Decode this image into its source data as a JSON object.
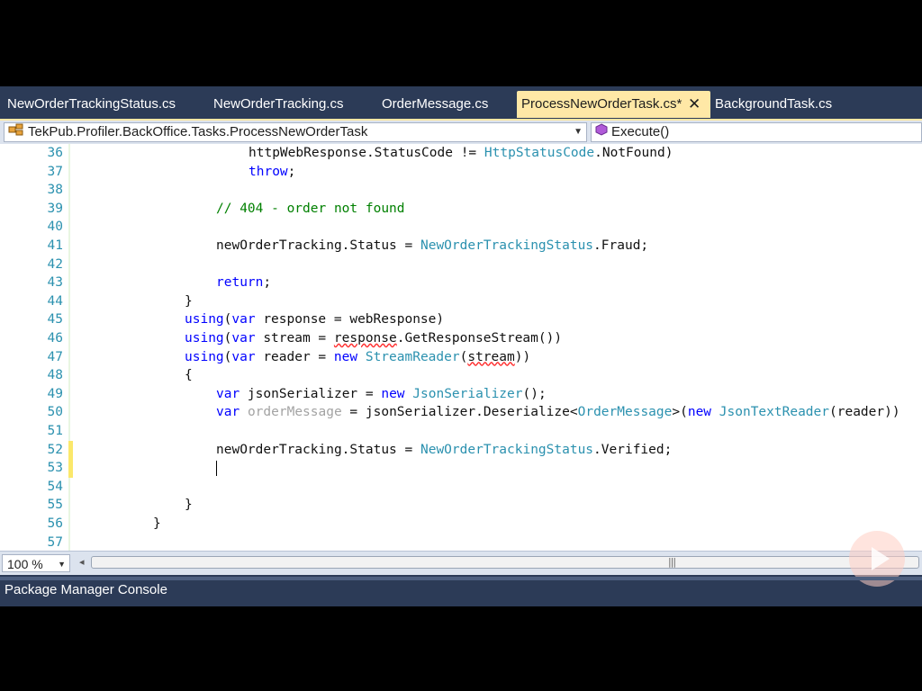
{
  "tabs": [
    {
      "label": "NewOrderTrackingStatus.cs"
    },
    {
      "label": "NewOrderTracking.cs"
    },
    {
      "label": "OrderMessage.cs"
    },
    {
      "label": "ProcessNewOrderTask.cs*",
      "active": true
    },
    {
      "label": "BackgroundTask.cs"
    }
  ],
  "tab_close_glyph": "✕",
  "navbar": {
    "type_combo": "TekPub.Profiler.BackOffice.Tasks.ProcessNewOrderTask",
    "member_combo": "Execute()"
  },
  "lines": [
    {
      "n": "36",
      "code": "httpWebResponse.StatusCode != HttpStatusCode.NotFound)"
    },
    {
      "n": "37",
      "code": "throw;"
    },
    {
      "n": "38",
      "code": ""
    },
    {
      "n": "39",
      "code": "// 404 - order not found"
    },
    {
      "n": "40",
      "code": ""
    },
    {
      "n": "41",
      "code": "newOrderTracking.Status = NewOrderTrackingStatus.Fraud;"
    },
    {
      "n": "42",
      "code": ""
    },
    {
      "n": "43",
      "code": "return;"
    },
    {
      "n": "44",
      "code": "}"
    },
    {
      "n": "45",
      "code": "using(var response = webResponse)"
    },
    {
      "n": "46",
      "code": "using(var stream = response.GetResponseStream())"
    },
    {
      "n": "47",
      "code": "using(var reader = new StreamReader(stream))"
    },
    {
      "n": "48",
      "code": "{"
    },
    {
      "n": "49",
      "code": "var jsonSerializer = new JsonSerializer();"
    },
    {
      "n": "50",
      "code": "var orderMessage = jsonSerializer.Deserialize<OrderMessage>(new JsonTextReader(reader))"
    },
    {
      "n": "51",
      "code": ""
    },
    {
      "n": "52",
      "code": "newOrderTracking.Status = NewOrderTrackingStatus.Verified;"
    },
    {
      "n": "53",
      "code": ""
    },
    {
      "n": "54",
      "code": ""
    },
    {
      "n": "55",
      "code": "}"
    },
    {
      "n": "56",
      "code": "}"
    },
    {
      "n": "57",
      "code": ""
    }
  ],
  "zoom": "100 %",
  "bottom_panel": "Package Manager Console",
  "colors": {
    "chrome": "#2c3b57",
    "active_tab": "#ffe8a6",
    "keyword": "#0000ff",
    "type": "#2b91af",
    "comment": "#008000",
    "change_marker": "#fbe86b"
  }
}
